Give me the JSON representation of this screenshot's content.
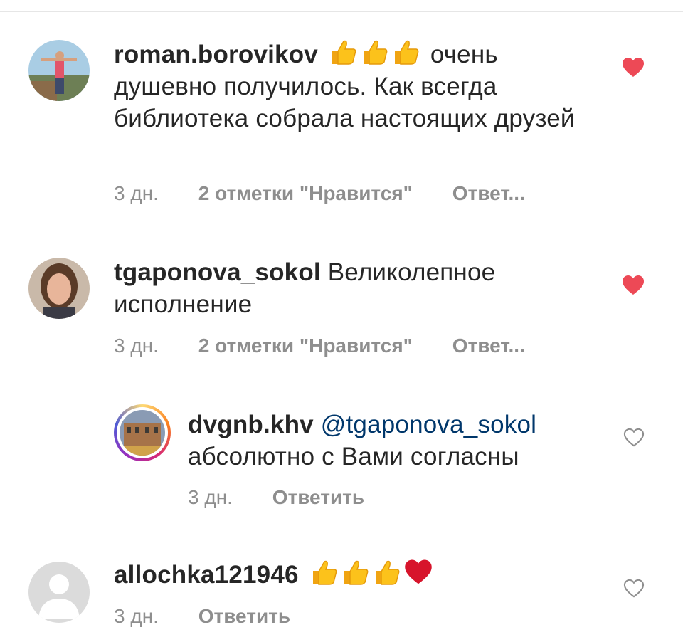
{
  "comments": [
    {
      "username": "roman.borovikov",
      "emoji_after_name": [
        "thumbs-up",
        "thumbs-up",
        "thumbs-up"
      ],
      "text": "очень душевно получилось. Как всегда библиотека собрала настоящих друзей",
      "time": "3 дн.",
      "likes": "2 отметки \"Нравится\"",
      "reply": "Ответ...",
      "liked": true
    },
    {
      "username": "tgaponova_sokol",
      "text": "Великолепное исполнение",
      "time": "3 дн.",
      "likes": "2 отметки \"Нравится\"",
      "reply": "Ответ...",
      "liked": true
    },
    {
      "username": "dvgnb.khv",
      "mention": "@tgaponova_sokol",
      "text": "абсолютно с Вами согласны",
      "time": "3 дн.",
      "reply": "Ответить",
      "liked": false,
      "is_reply": true
    },
    {
      "username": "allochka121946",
      "emoji_after_name": [
        "thumbs-up",
        "thumbs-up",
        "thumbs-up",
        "red-heart"
      ],
      "time": "3 дн.",
      "reply": "Ответить",
      "liked": false
    }
  ],
  "colors": {
    "text": "#262626",
    "muted": "#8e8e8e",
    "liked_heart": "#ed4956",
    "mention": "#00376b"
  }
}
